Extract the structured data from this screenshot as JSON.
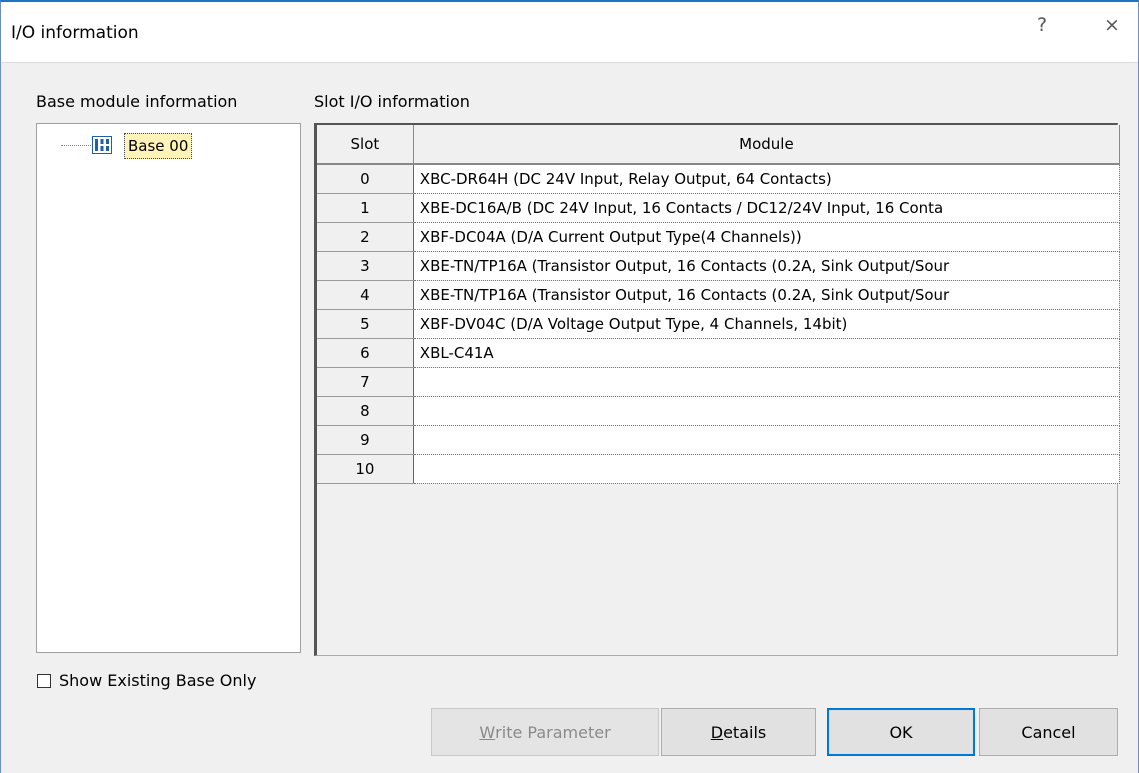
{
  "window": {
    "title": "I/O information",
    "help_label": "?",
    "close_label": "×"
  },
  "labels": {
    "base_module": "Base module information",
    "slot_io": "Slot I/O information"
  },
  "tree": {
    "base_label": "Base 00"
  },
  "table": {
    "headers": {
      "slot": "Slot",
      "module": "Module"
    },
    "rows": [
      {
        "slot": "0",
        "module": "XBC-DR64H (DC 24V Input, Relay Output, 64 Contacts)"
      },
      {
        "slot": "1",
        "module": "XBE-DC16A/B (DC 24V Input, 16 Contacts / DC12/24V Input, 16 Conta"
      },
      {
        "slot": "2",
        "module": "XBF-DC04A (D/A Current Output Type(4 Channels))"
      },
      {
        "slot": "3",
        "module": "XBE-TN/TP16A (Transistor Output, 16 Contacts (0.2A, Sink Output/Sour"
      },
      {
        "slot": "4",
        "module": "XBE-TN/TP16A (Transistor Output, 16 Contacts (0.2A, Sink Output/Sour"
      },
      {
        "slot": "5",
        "module": "XBF-DV04C (D/A Voltage Output Type, 4 Channels, 14bit)"
      },
      {
        "slot": "6",
        "module": "XBL-C41A"
      },
      {
        "slot": "7",
        "module": ""
      },
      {
        "slot": "8",
        "module": ""
      },
      {
        "slot": "9",
        "module": ""
      },
      {
        "slot": "10",
        "module": ""
      }
    ]
  },
  "checkbox": {
    "label": "Show Existing Base Only",
    "checked": false
  },
  "buttons": {
    "write_parameter": {
      "mnemonic": "W",
      "rest": "rite Parameter",
      "enabled": false
    },
    "details": {
      "mnemonic": "D",
      "rest": "etails"
    },
    "ok": "OK",
    "cancel": "Cancel"
  },
  "colors": {
    "accent": "#0078d7",
    "selection": "#fff3b8"
  }
}
